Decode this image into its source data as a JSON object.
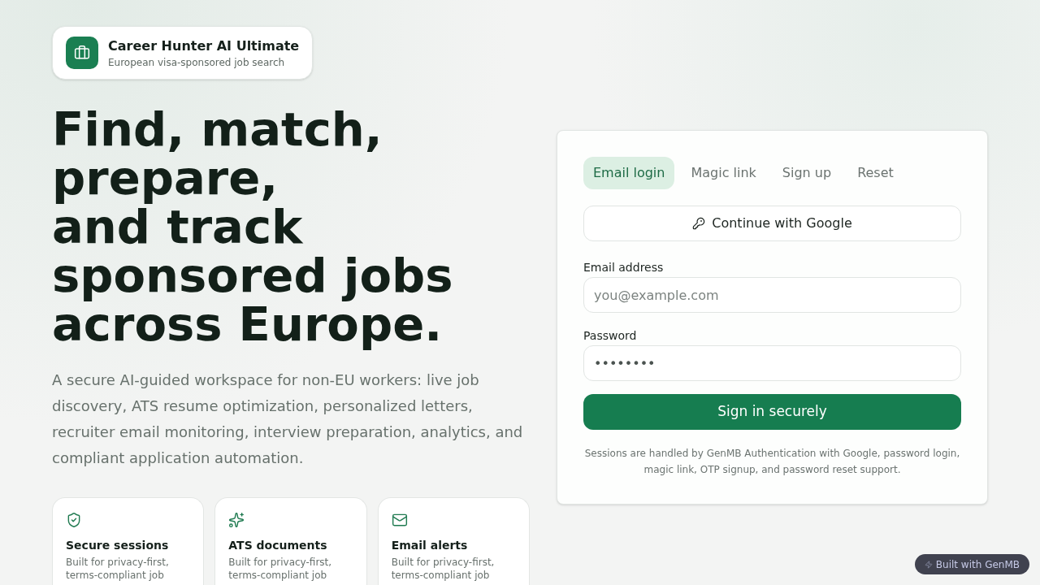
{
  "brand": {
    "title": "Career Hunter AI Ultimate",
    "subtitle": "European visa-sponsored job search"
  },
  "hero": {
    "heading_lines": [
      "Find, match, prepare,",
      "and track sponsored jobs across Europe."
    ],
    "description": "A secure AI-guided workspace for non-EU workers: live job discovery, ATS resume optimization, personalized letters, recruiter email monitoring, interview preparation, analytics, and compliant application automation."
  },
  "features": [
    {
      "title": "Secure sessions",
      "description": "Built for privacy-first, terms-compliant job"
    },
    {
      "title": "ATS documents",
      "description": "Built for privacy-first, terms-compliant job"
    },
    {
      "title": "Email alerts",
      "description": "Built for privacy-first, terms-compliant job"
    }
  ],
  "auth": {
    "tabs": [
      {
        "label": "Email login",
        "selected": true
      },
      {
        "label": "Magic link",
        "selected": false
      },
      {
        "label": "Sign up",
        "selected": false
      },
      {
        "label": "Reset",
        "selected": false
      }
    ],
    "google_button": "Continue with Google",
    "fields": [
      {
        "label": "Email address",
        "placeholder": "you@example.com"
      },
      {
        "label": "Password",
        "value": "••••••••"
      }
    ],
    "submit_button": "Sign in securely",
    "note": "Sessions are handled by GenMB Authentication with Google, password login, magic link, OTP signup, and password reset support."
  },
  "badge": "Built with GenMB"
}
